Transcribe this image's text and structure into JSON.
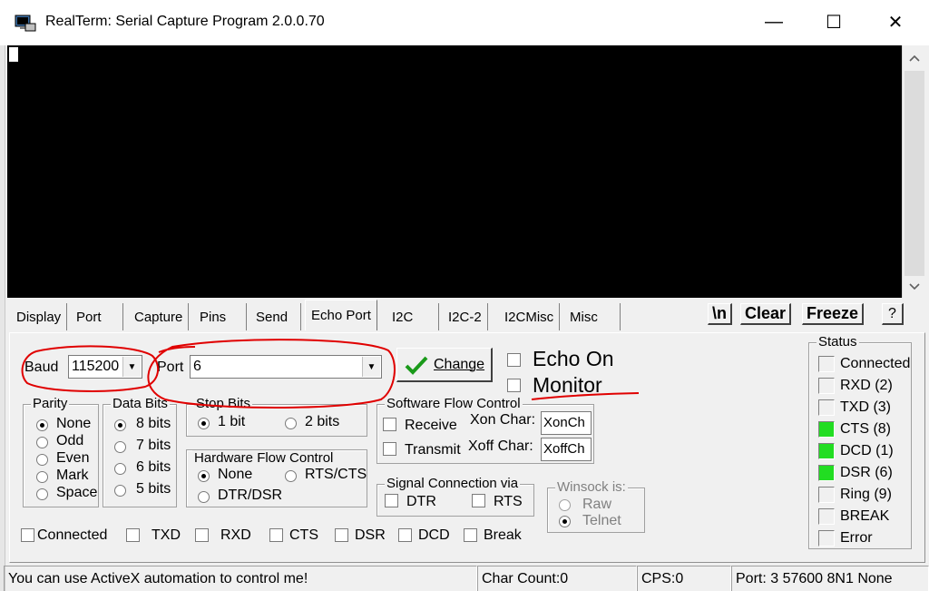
{
  "window": {
    "title": "RealTerm: Serial Capture Program 2.0.0.70",
    "minimize_glyph": "—",
    "maximize_glyph": "☐",
    "close_glyph": "✕"
  },
  "tabs": [
    {
      "label": "Display"
    },
    {
      "label": "Port"
    },
    {
      "label": "Capture"
    },
    {
      "label": "Pins"
    },
    {
      "label": "Send"
    },
    {
      "label": "Echo Port",
      "active": true
    },
    {
      "label": "I2C"
    },
    {
      "label": "I2C-2"
    },
    {
      "label": "I2CMisc"
    },
    {
      "label": "Misc"
    }
  ],
  "tab_buttons": {
    "newline": "\\n",
    "clear": "Clear",
    "freeze": "Freeze",
    "help": "?"
  },
  "port": {
    "baud_label": "Baud",
    "baud_value": "115200",
    "port_label": "Port",
    "port_value": "6",
    "change_label": "Change",
    "echo_on_label": "Echo On",
    "monitor_label": "Monitor"
  },
  "parity": {
    "title": "Parity",
    "options": [
      "None",
      "Odd",
      "Even",
      "Mark",
      "Space"
    ],
    "selected": "None"
  },
  "data_bits": {
    "title": "Data Bits",
    "options": [
      "8 bits",
      "7 bits",
      "6 bits",
      "5 bits"
    ],
    "selected": "8 bits"
  },
  "stop_bits": {
    "title": "Stop Bits",
    "options": [
      "1 bit",
      "2 bits"
    ],
    "selected": "1 bit"
  },
  "hw_flow": {
    "title": "Hardware Flow Control",
    "options": [
      "None",
      "RTS/CTS",
      "DTR/DSR"
    ],
    "selected": "None"
  },
  "sw_flow": {
    "title": "Software Flow Control",
    "receive": "Receive",
    "transmit": "Transmit",
    "xon_label": "Xon Char:",
    "xon_value": "XonCh",
    "xoff_label": "Xoff Char:",
    "xoff_value": "XoffCh"
  },
  "signal": {
    "title": "Signal Connection via",
    "dtr": "DTR",
    "rts": "RTS"
  },
  "winsock": {
    "title": "Winsock is:",
    "options": [
      "Raw",
      "Telnet"
    ],
    "selected": "Telnet"
  },
  "bottom_checks": [
    "Connected",
    "TXD",
    "RXD",
    "CTS",
    "DSR",
    "DCD",
    "Break"
  ],
  "status": {
    "title": "Status",
    "items": [
      {
        "label": "Connected",
        "on": false
      },
      {
        "label": "RXD (2)",
        "on": false
      },
      {
        "label": "TXD (3)",
        "on": false
      },
      {
        "label": "CTS (8)",
        "on": true
      },
      {
        "label": "DCD (1)",
        "on": true
      },
      {
        "label": "DSR (6)",
        "on": true
      },
      {
        "label": "Ring (9)",
        "on": false
      },
      {
        "label": "BREAK",
        "on": false
      },
      {
        "label": "Error",
        "on": false
      }
    ],
    "led_on_color": "#22dd22"
  },
  "statusbar": {
    "message": "You can use ActiveX automation to control me!",
    "char_count": "Char Count:0",
    "cps": "CPS:0",
    "port_info": "Port: 3 57600 8N1 None"
  },
  "annotation_color": "#e00000"
}
